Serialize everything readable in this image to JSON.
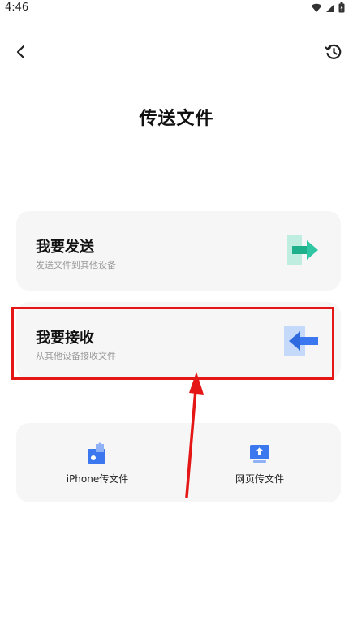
{
  "status": {
    "time": "4:46"
  },
  "page": {
    "title": "传送文件"
  },
  "send_card": {
    "title": "我要发送",
    "subtitle": "发送文件到其他设备"
  },
  "receive_card": {
    "title": "我要接收",
    "subtitle": "从其他设备接收文件"
  },
  "tools": [
    {
      "label": "iPhone传文件",
      "icon": "iphone-transfer-icon"
    },
    {
      "label": "网页传文件",
      "icon": "web-transfer-icon"
    }
  ],
  "icons": {
    "back": "chevron-left-icon",
    "history": "history-icon"
  },
  "colors": {
    "send_accent": "#2fc7a3",
    "receive_accent": "#3b78ef",
    "highlight": "#e51616",
    "card_bg": "#f6f6f6"
  }
}
